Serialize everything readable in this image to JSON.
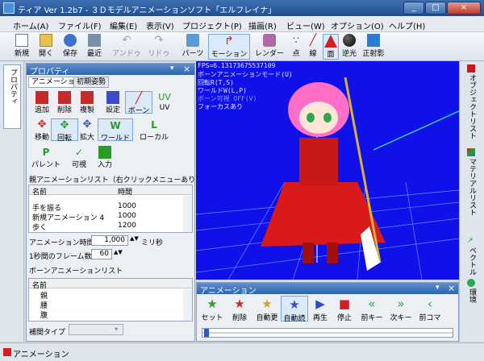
{
  "window": {
    "title": "ティア Ver 1.2b7 - ３Ｄモデルアニメーションソフト「エルフレイナ」"
  },
  "menu": [
    "ホーム(A)",
    "ファイル(F)",
    "編集(E)",
    "表示(V)",
    "プロジェクト(P)",
    "描画(R)",
    "ビュー(W)",
    "オプション(O)",
    "ヘルプ(H)"
  ],
  "toolbar": {
    "new": "新規",
    "open": "開く",
    "save": "保存",
    "recent": "最近",
    "undo": "アンドゥ",
    "redo": "リドゥ",
    "parts": "パーツ",
    "motion": "モーション",
    "render": "レンダー",
    "point": "点",
    "line": "線",
    "face": "面",
    "backlight": "逆光",
    "ortho": "正射影"
  },
  "side_tab": {
    "label": "プロパティ"
  },
  "properties": {
    "header": "プロパティ",
    "tabs": [
      "アニメーション",
      "初期姿勢"
    ],
    "row1": [
      "追加",
      "削除",
      "複製",
      "設定",
      "ボーン",
      "UV"
    ],
    "row2": [
      "移動",
      "回転",
      "拡大",
      "ワールド",
      "ローカル"
    ],
    "row3": [
      "パレント",
      "可視",
      "入力"
    ],
    "anim_list_label": "親アニメーションリスト（右クリックメニューあり）",
    "anim_list_headers": [
      "名前",
      "時間"
    ],
    "anim_list_rows": [
      {
        "name": "手を振る",
        "time": "1000"
      },
      {
        "name": "新規アニメーション 4",
        "time": "1000"
      },
      {
        "name": "歩く",
        "time": "1200"
      }
    ],
    "anim_time_label": "アニメーション時間",
    "anim_time_value": "1,000",
    "anim_time_unit": "ミリ秒",
    "fps_label": "1秒間のフレーム数",
    "fps_value": "60",
    "bone_list_label": "ボーンアニメーションリスト",
    "bone_list_header": "名前",
    "bone_list_rows": [
      "親",
      "腰",
      "腹"
    ],
    "interp_label": "補間タイプ"
  },
  "viewport": {
    "info_lines": [
      "FPS=6.13173675537109",
      "ボーンアニメーションモード(U)",
      "回転R(T,S)",
      "ワールドW(L,P)",
      "ボーン可視 OFF(V)",
      "フォーカスあり"
    ]
  },
  "right_tabs": [
    "オブジェクトリスト",
    "マテリアルリスト",
    "ベクトル",
    "環境"
  ],
  "animation_panel": {
    "header": "アニメーション",
    "buttons": [
      "セット",
      "削除",
      "自動更",
      "自動読",
      "再生",
      "停止",
      "前キー",
      "次キー",
      "前コマ"
    ]
  },
  "status": {
    "label": "アニメーション"
  }
}
